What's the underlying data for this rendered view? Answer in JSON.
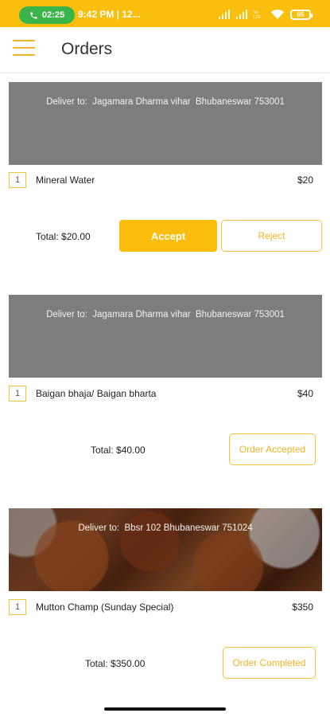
{
  "status_bar": {
    "call_time": "02:25",
    "time": "9:42 PM | 12...",
    "battery": "65"
  },
  "app_bar": {
    "title": "Orders",
    "menu_icon": "hamburger-menu-icon"
  },
  "orders": [
    {
      "deliver_to": "Deliver to:  Jagamara Dharma vihar  Bhubaneswar 753001",
      "items": [
        {
          "qty": "1",
          "name": "Mineral Water",
          "price": "$20"
        }
      ],
      "total": "Total: $20.00",
      "accept_label": "Accept",
      "reject_label": "Reject"
    },
    {
      "deliver_to": "Deliver to:  Jagamara Dharma vihar  Bhubaneswar 753001",
      "items": [
        {
          "qty": "1",
          "name": "Baigan bhaja/ Baigan bharta",
          "price": "$40"
        }
      ],
      "total": "Total: $40.00",
      "status_label": "Order Accepted"
    },
    {
      "deliver_to": "Deliver to:  Bbsr 102 Bhubaneswar 751024",
      "items": [
        {
          "qty": "1",
          "name": "Mutton Champ (Sunday Special)",
          "price": "$350"
        }
      ],
      "total": "Total: $350.00",
      "status_label": "Order Completed"
    }
  ],
  "colors": {
    "accent": "#fbbd0c",
    "status_bar": "#f9bf0c",
    "call_pill": "#3bb54a"
  }
}
